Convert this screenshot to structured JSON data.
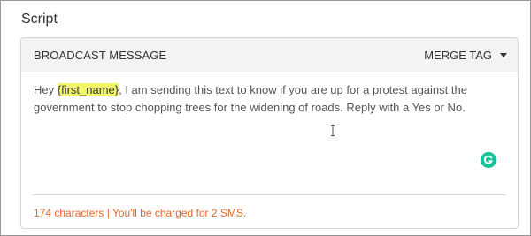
{
  "section": {
    "title": "Script"
  },
  "card": {
    "header_title": "BROADCAST MESSAGE",
    "merge_tag_label": "MERGE TAG"
  },
  "message": {
    "prefix": "Hey ",
    "merge_tag": "{first_name}",
    "body": ", I am sending this text to know if you are up for a protest against the government to stop chopping trees for the widening of roads. Reply with a Yes or No."
  },
  "footer": {
    "status": "174 characters | You'll be charged for 2 SMS."
  },
  "icons": {
    "merge_tag_caret": "caret-down-icon",
    "cursor": "text-cursor-icon",
    "grammarly": "grammarly-icon"
  },
  "colors": {
    "highlight": "#f2f56a",
    "status_text": "#e0692c",
    "grammarly": "#15c39a"
  }
}
